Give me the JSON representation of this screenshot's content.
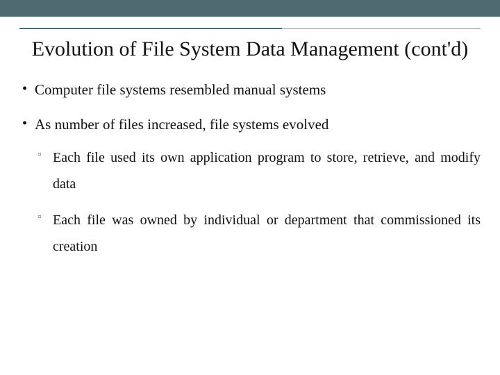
{
  "title": "Evolution of File System Data Management (cont'd)",
  "bullets": [
    {
      "text": "Computer file systems resembled manual systems"
    },
    {
      "text": "As number of files increased, file systems evolved",
      "sub": [
        "Each file used its own application program to store, retrieve, and modify data",
        "Each file was owned by individual or department that commissioned its creation"
      ]
    }
  ]
}
